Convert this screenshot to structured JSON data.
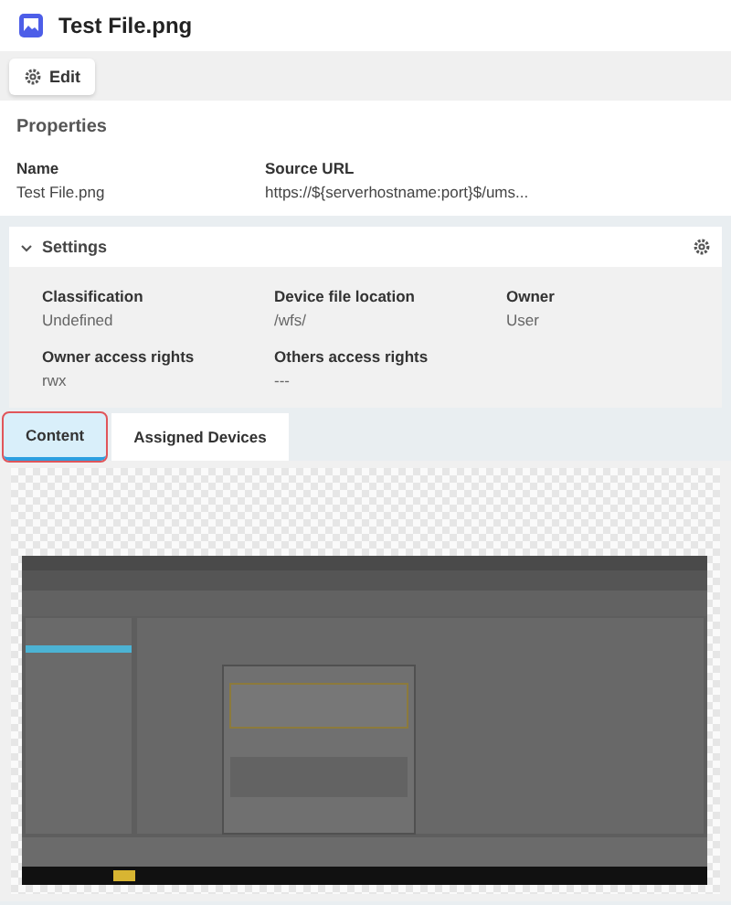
{
  "header": {
    "title": "Test File.png"
  },
  "toolbar": {
    "buttons": [
      {
        "label": "Edit"
      }
    ]
  },
  "properties": {
    "title": "Properties",
    "fields": [
      {
        "label": "Name",
        "value": "Test File.png"
      },
      {
        "label": "Source URL",
        "value": "https://${serverhostname:port}$/ums..."
      }
    ]
  },
  "settings": {
    "title": "Settings",
    "expanded": true,
    "fields": [
      {
        "label": "Classification",
        "value": "Undefined"
      },
      {
        "label": "Device file location",
        "value": "/wfs/"
      },
      {
        "label": "Owner",
        "value": "User"
      },
      {
        "label": "Owner access rights",
        "value": "rwx"
      },
      {
        "label": "Others access rights",
        "value": "---"
      }
    ]
  },
  "tabs": [
    {
      "label": "Content",
      "selected": true,
      "highlighted": true
    },
    {
      "label": "Assigned Devices",
      "selected": false,
      "highlighted": false
    }
  ]
}
